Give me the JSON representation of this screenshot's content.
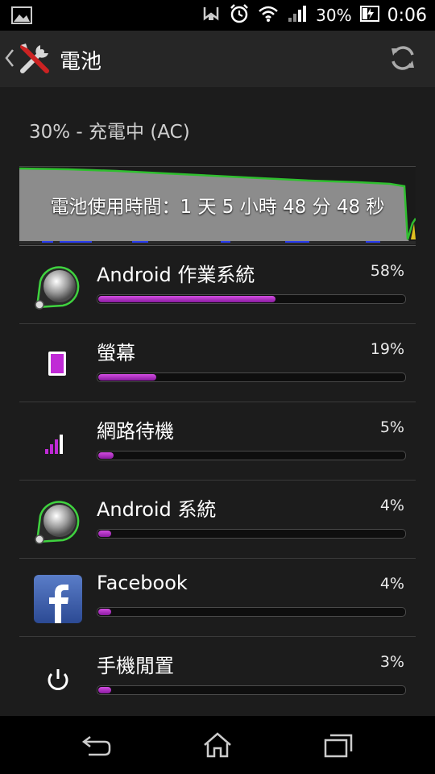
{
  "status_bar": {
    "battery_percent": "30%",
    "time": "0:06",
    "icons": [
      "image-icon",
      "nfc-icon",
      "alarm-icon",
      "wifi-icon",
      "signal-icon",
      "battery-charging-icon"
    ]
  },
  "action_bar": {
    "title": "電池",
    "icons": [
      "back-chevron-icon",
      "tools-icon",
      "refresh-icon"
    ]
  },
  "battery": {
    "status_text": "30% - 充電中 (AC)",
    "usage_time_caption": "電池使用時間：1 天 5 小時 48 分 48 秒",
    "graph_color": "#2fbf2f"
  },
  "items": [
    {
      "name": "Android 作業系統",
      "percent_text": "58%",
      "percent": 58,
      "icon": "android-os-icon"
    },
    {
      "name": "螢幕",
      "percent_text": "19%",
      "percent": 19,
      "icon": "screen-icon"
    },
    {
      "name": "網路待機",
      "percent_text": "5%",
      "percent": 5,
      "icon": "cell-standby-icon"
    },
    {
      "name": "Android 系統",
      "percent_text": "4%",
      "percent": 4,
      "icon": "android-system-icon"
    },
    {
      "name": "Facebook",
      "percent_text": "4%",
      "percent": 4,
      "icon": "facebook-icon"
    },
    {
      "name": "手機閒置",
      "percent_text": "3%",
      "percent": 3,
      "icon": "power-icon"
    }
  ],
  "nav_bar": {
    "icons": [
      "back-icon",
      "home-icon",
      "recent-apps-icon"
    ]
  },
  "colors": {
    "accent": "#b630c8",
    "graph_line": "#2fbf2f",
    "background": "#1c1c1c"
  }
}
